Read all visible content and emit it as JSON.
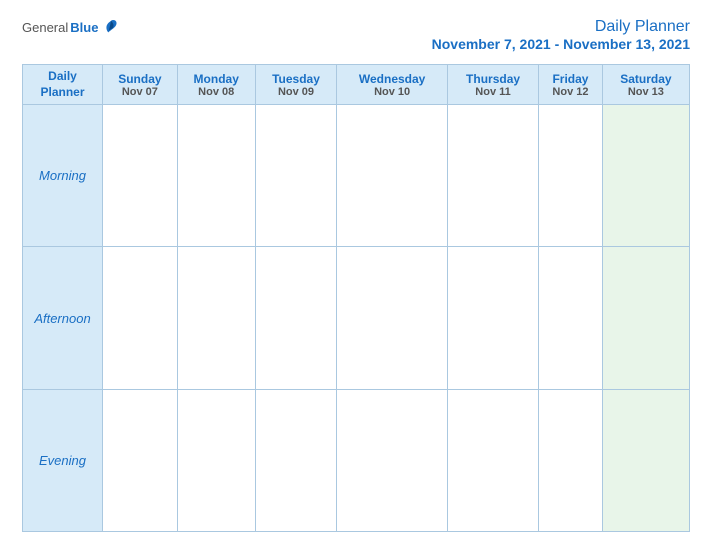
{
  "header": {
    "logo_general": "General",
    "logo_blue": "Blue",
    "title": "Daily Planner",
    "date_range": "November 7, 2021 - November 13, 2021"
  },
  "table": {
    "corner_label_line1": "Daily",
    "corner_label_line2": "Planner",
    "days": [
      {
        "name": "Sunday",
        "date": "Nov 07"
      },
      {
        "name": "Monday",
        "date": "Nov 08"
      },
      {
        "name": "Tuesday",
        "date": "Nov 09"
      },
      {
        "name": "Wednesday",
        "date": "Nov 10"
      },
      {
        "name": "Thursday",
        "date": "Nov 11"
      },
      {
        "name": "Friday",
        "date": "Nov 12"
      },
      {
        "name": "Saturday",
        "date": "Nov 13"
      }
    ],
    "rows": [
      {
        "label": "Morning"
      },
      {
        "label": "Afternoon"
      },
      {
        "label": "Evening"
      }
    ]
  }
}
